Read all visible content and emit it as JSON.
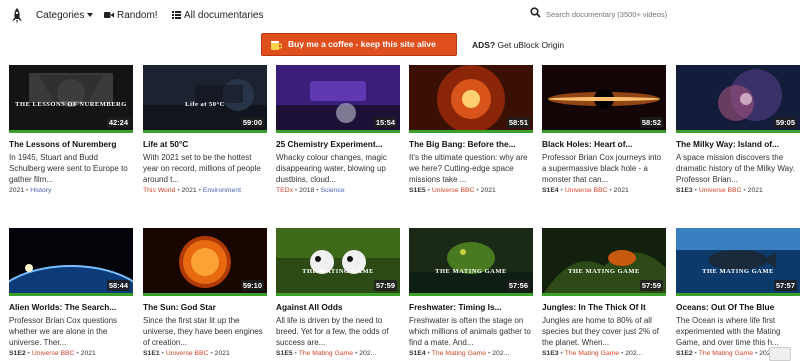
{
  "nav": {
    "categories": "Categories",
    "random": "Random!",
    "all": "All documentaries"
  },
  "search": {
    "placeholder": "Search documentary (3500+ videos)"
  },
  "banner": {
    "coffee": "Buy me a coffee - keep this site alive",
    "ads_bold": "ADS?",
    "ads_text": " Get uBlock Origin"
  },
  "row1": [
    {
      "title": "The Lessons of Nuremberg",
      "desc": "In 1945, Stuart and Budd Schulberg were sent to Europe to gather film...",
      "dur": "42:24",
      "meta": {
        "ep": "",
        "year": "2021",
        "tags": [
          {
            "t": "History",
            "c": "blue"
          }
        ]
      },
      "caption": "THE LESSONS OF NUREMBERG"
    },
    {
      "title": "Life at 50°C",
      "desc": "With 2021 set to be the hottest year on record, millions of people around t...",
      "dur": "59:00",
      "meta": {
        "ep": "",
        "year": "2021",
        "tags": [
          {
            "t": "This World",
            "c": "red"
          },
          {
            "t": "Environment",
            "c": "blue"
          }
        ]
      },
      "caption": "Life at 50°C"
    },
    {
      "title": "25 Chemistry Experiment...",
      "desc": "Whacky colour changes, magic disappearing water, blowing up dustbins, cloud...",
      "dur": "15:54",
      "meta": {
        "ep": "",
        "year": "2018",
        "tags": [
          {
            "t": "TEDx",
            "c": "red"
          },
          {
            "t": "Science",
            "c": "blue"
          }
        ]
      },
      "caption": ""
    },
    {
      "title": "The Big Bang: Before the...",
      "desc": "It's the ultimate question: why are we here? Cutting-edge space missions take ...",
      "dur": "58:51",
      "meta": {
        "ep": "S1E5",
        "year": "2021",
        "tags": [
          {
            "t": "Universe BBC",
            "c": "red"
          }
        ]
      },
      "caption": ""
    },
    {
      "title": "Black Holes: Heart of...",
      "desc": "Professor Brian Cox journeys into a supermassive black hole - a monster that can...",
      "dur": "58:52",
      "meta": {
        "ep": "S1E4",
        "year": "2021",
        "tags": [
          {
            "t": "Universe BBC",
            "c": "red"
          }
        ]
      },
      "caption": ""
    },
    {
      "title": "The Milky Way: Island of...",
      "desc": "A space mission discovers the dramatic history of the Milky Way. Professor Brian...",
      "dur": "59:05",
      "meta": {
        "ep": "S1E3",
        "year": "2021",
        "tags": [
          {
            "t": "Universe BBC",
            "c": "red"
          }
        ]
      },
      "caption": ""
    }
  ],
  "row2": [
    {
      "title": "Alien Worlds: The Search...",
      "desc": "Professor Brian Cox questions whether we are alone in the universe. Ther...",
      "dur": "58:44",
      "meta": {
        "ep": "S1E2",
        "year": "2021",
        "tags": [
          {
            "t": "Universe BBC",
            "c": "red"
          }
        ]
      },
      "caption": ""
    },
    {
      "title": "The Sun: God Star",
      "desc": "Since the first star lit up the universe, they have been engines of creation...",
      "dur": "59:10",
      "meta": {
        "ep": "S1E1",
        "year": "2021",
        "tags": [
          {
            "t": "Universe BBC",
            "c": "red"
          }
        ]
      },
      "caption": ""
    },
    {
      "title": "Against All Odds",
      "desc": "All life is driven by the need to breed. Yet for a few, the odds of success are...",
      "dur": "57:59",
      "meta": {
        "ep": "S1E5",
        "year": "202...",
        "tags": [
          {
            "t": "The Mating Game",
            "c": "red"
          }
        ]
      },
      "caption": "THE MATING GAME"
    },
    {
      "title": "Freshwater: Timing Is...",
      "desc": "Freshwater is often the stage on which millions of animals gather to find a mate. And...",
      "dur": "57:56",
      "meta": {
        "ep": "S1E4",
        "year": "202...",
        "tags": [
          {
            "t": "The Mating Game",
            "c": "red"
          }
        ]
      },
      "caption": "THE MATING GAME"
    },
    {
      "title": "Jungles: In The Thick Of It",
      "desc": "Jungles are home to 80% of all species but they cover just 2% of the planet. When...",
      "dur": "57:59",
      "meta": {
        "ep": "S1E3",
        "year": "202...",
        "tags": [
          {
            "t": "The Mating Game",
            "c": "red"
          }
        ]
      },
      "caption": "THE MATING GAME"
    },
    {
      "title": "Oceans: Out Of The Blue",
      "desc": "The Ocean is where life first experimented with the Mating Game, and over time this h...",
      "dur": "57:57",
      "meta": {
        "ep": "S1E2",
        "year": "202...",
        "tags": [
          {
            "t": "The Mating Game",
            "c": "red"
          }
        ]
      },
      "caption": "THE MATING GAME"
    }
  ]
}
